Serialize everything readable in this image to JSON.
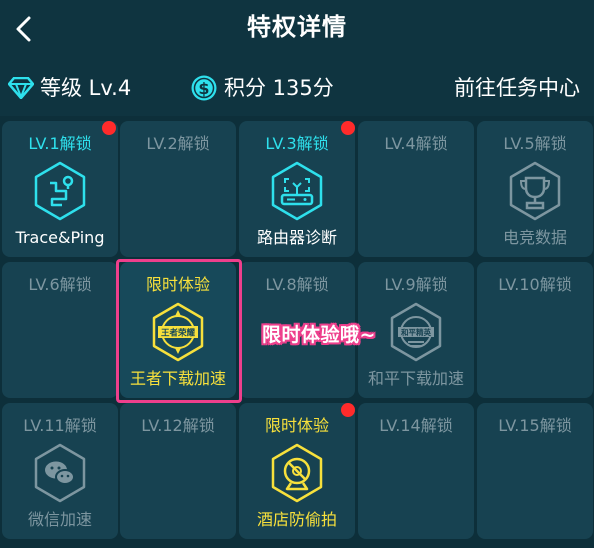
{
  "header": {
    "title": "特权详情",
    "back_icon": "chevron-left-icon"
  },
  "info": {
    "level_text": "等级 Lv.4",
    "points_text": "积分 135分",
    "task_link": "前往任务中心",
    "accent_color": "#2ee0ec"
  },
  "privileges": [
    {
      "lv": "LV.1解锁",
      "name": "Trace&Ping",
      "icon": "route-trace-icon",
      "state": "unlocked",
      "dot": true
    },
    {
      "lv": "LV.2解锁",
      "name": "",
      "icon": "",
      "state": "locked",
      "dot": false
    },
    {
      "lv": "LV.3解锁",
      "name": "路由器诊断",
      "icon": "router-icon",
      "state": "unlocked",
      "dot": true
    },
    {
      "lv": "LV.4解锁",
      "name": "",
      "icon": "",
      "state": "locked",
      "dot": false
    },
    {
      "lv": "LV.5解锁",
      "name": "电竞数据",
      "icon": "trophy-icon",
      "state": "locked",
      "dot": false
    },
    {
      "lv": "LV.6解锁",
      "name": "",
      "icon": "",
      "state": "locked",
      "dot": false
    },
    {
      "lv": "限时体验",
      "name": "王者下载加速",
      "icon": "honor-of-kings-icon",
      "state": "trial",
      "dot": false
    },
    {
      "lv": "LV.8解锁",
      "name": "",
      "icon": "",
      "state": "locked",
      "dot": false
    },
    {
      "lv": "LV.9解锁",
      "name": "和平下载加速",
      "icon": "peace-elite-icon",
      "state": "locked",
      "dot": false
    },
    {
      "lv": "LV.10解锁",
      "name": "",
      "icon": "",
      "state": "locked",
      "dot": false
    },
    {
      "lv": "LV.11解锁",
      "name": "微信加速",
      "icon": "wechat-icon",
      "state": "locked",
      "dot": false
    },
    {
      "lv": "LV.12解锁",
      "name": "",
      "icon": "",
      "state": "locked",
      "dot": false
    },
    {
      "lv": "限时体验",
      "name": "酒店防偷拍",
      "icon": "no-camera-icon",
      "state": "trial",
      "dot": true
    },
    {
      "lv": "LV.14解锁",
      "name": "",
      "icon": "",
      "state": "locked",
      "dot": false
    },
    {
      "lv": "LV.15解锁",
      "name": "",
      "icon": "",
      "state": "locked",
      "dot": false
    }
  ],
  "wzry_logo_text": "王者荣耀",
  "hpjy_logo_text": "和平精英",
  "callout": "限时体验哦~"
}
